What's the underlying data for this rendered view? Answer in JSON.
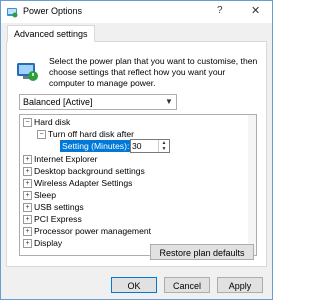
{
  "window": {
    "title": "Power Options",
    "help_glyph": "?",
    "close_glyph": "✕"
  },
  "tab": {
    "label": "Advanced settings"
  },
  "description": "Select the power plan that you want to customise, then choose settings that reflect how you want your computer to manage power.",
  "plan_select": {
    "value": "Balanced [Active]"
  },
  "tree": {
    "hard_disk": "Hard disk",
    "turn_off": "Turn off hard disk after",
    "setting_label": "Setting (Minutes):",
    "setting_value": "30",
    "items": [
      "Internet Explorer",
      "Desktop background settings",
      "Wireless Adapter Settings",
      "Sleep",
      "USB settings",
      "PCI Express",
      "Processor power management",
      "Display"
    ]
  },
  "buttons": {
    "restore": "Restore plan defaults",
    "ok": "OK",
    "cancel": "Cancel",
    "apply": "Apply"
  },
  "colors": {
    "selection": "#0078d7",
    "accent_border": "#6a9bd1"
  }
}
